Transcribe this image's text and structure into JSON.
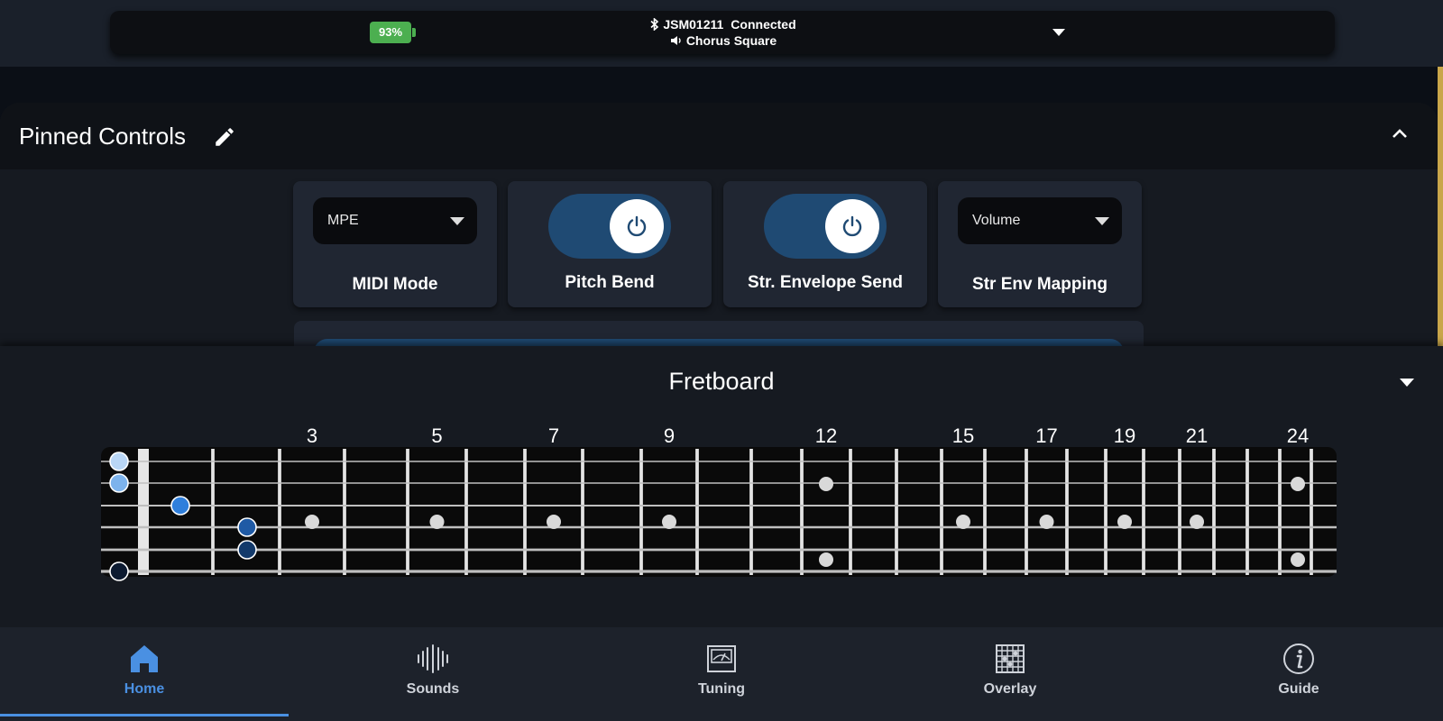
{
  "status": {
    "battery": "93%",
    "device_id": "JSM01211",
    "connection": "Connected",
    "sound": "Chorus Square"
  },
  "pinned": {
    "title": "Pinned Controls",
    "controls": [
      {
        "type": "select",
        "value": "MPE",
        "label": "MIDI Mode"
      },
      {
        "type": "toggle",
        "on": true,
        "label": "Pitch Bend"
      },
      {
        "type": "toggle",
        "on": true,
        "label": "Str. Envelope Send"
      },
      {
        "type": "select",
        "value": "Volume",
        "label": "Str Env Mapping"
      }
    ]
  },
  "fretboard": {
    "title": "Fretboard",
    "fret_numbers": [
      "3",
      "5",
      "7",
      "9",
      "12",
      "15",
      "17",
      "19",
      "21",
      "24"
    ],
    "finger_markers": [
      {
        "string": 1,
        "fret": 0,
        "color": "#b9d6f5"
      },
      {
        "string": 2,
        "fret": 0,
        "color": "#7db3ec"
      },
      {
        "string": 3,
        "fret": 2,
        "color": "#2f7fdc"
      },
      {
        "string": 4,
        "fret": 4,
        "color": "#1f5aa5"
      },
      {
        "string": 5,
        "fret": 4,
        "color": "#133a6b"
      },
      {
        "string": 6,
        "fret": 0,
        "color": "#0c1a30"
      }
    ],
    "colors": {
      "board": "#0a0a0a",
      "fret": "#c8c8c8",
      "inlay": "#d9d9d9"
    }
  },
  "nav": {
    "items": [
      {
        "label": "Home",
        "icon": "home-icon",
        "active": true
      },
      {
        "label": "Sounds",
        "icon": "sounds-icon",
        "active": false
      },
      {
        "label": "Tuning",
        "icon": "tuning-icon",
        "active": false
      },
      {
        "label": "Overlay",
        "icon": "overlay-icon",
        "active": false
      },
      {
        "label": "Guide",
        "icon": "guide-icon",
        "active": false
      }
    ],
    "accent": "#4a90e2"
  }
}
